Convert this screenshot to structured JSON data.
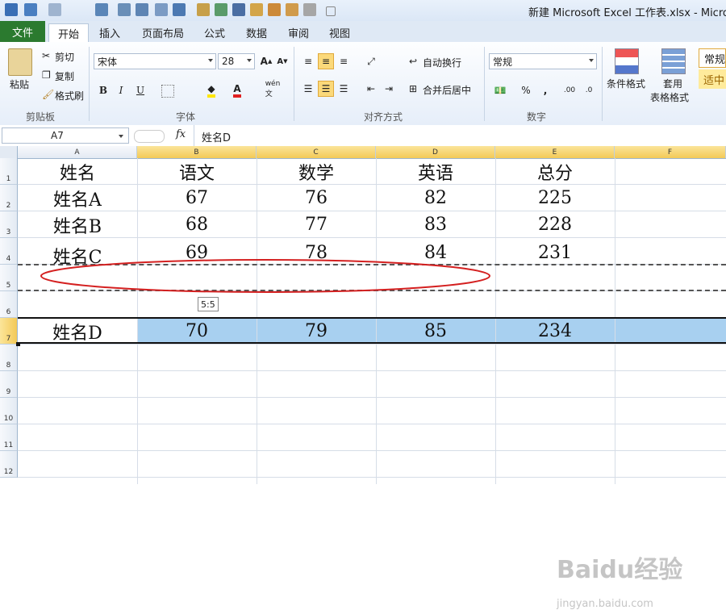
{
  "window": {
    "title": "新建 Microsoft Excel 工作表.xlsx - Microso"
  },
  "tabs": [
    "开始",
    "插入",
    "页面布局",
    "公式",
    "数据",
    "审阅",
    "视图"
  ],
  "file_tab": "文件",
  "ribbon": {
    "clipboard": {
      "paste": "粘贴",
      "cut": "剪切",
      "copy": "复制",
      "format_painter": "格式刷",
      "label": "剪贴板"
    },
    "font": {
      "name": "宋体",
      "size": "28",
      "label": "字体",
      "bold": "B",
      "italic": "I",
      "underline": "U"
    },
    "alignment": {
      "wrap": "自动换行",
      "merge": "合并后居中",
      "label": "对齐方式"
    },
    "number": {
      "format": "常规",
      "percent": "%",
      "comma": ",",
      "label": "数字"
    },
    "styles": {
      "conditional": "条件格式",
      "table_a": "套用",
      "table_b": "表格格式",
      "normal": "常规",
      "neutral": "适中"
    }
  },
  "formula_bar": {
    "name_box": "A7",
    "fx": "fx",
    "content": "姓名D"
  },
  "columns": [
    "A",
    "B",
    "C",
    "D",
    "E",
    "F"
  ],
  "rows": [
    "1",
    "2",
    "3",
    "4",
    "5",
    "6",
    "7",
    "8",
    "9",
    "10",
    "11",
    "12"
  ],
  "table": {
    "header": [
      "姓名",
      "语文",
      "数学",
      "英语",
      "总分"
    ],
    "rows": [
      [
        "姓名A",
        "67",
        "76",
        "82",
        "225"
      ],
      [
        "姓名B",
        "68",
        "77",
        "83",
        "228"
      ],
      [
        "姓名C",
        "69",
        "78",
        "84",
        "231"
      ],
      [
        "姓名D",
        "70",
        "79",
        "85",
        "234"
      ]
    ]
  },
  "drag_tooltip": "5:5",
  "watermark": {
    "brand": "Baidu经验",
    "url": "jingyan.baidu.com"
  },
  "colors": {
    "file_tab": "#2b7a2f",
    "selection": "#a8d0f0",
    "ellipse": "#d42020",
    "header_highlight": "#f3c957"
  }
}
